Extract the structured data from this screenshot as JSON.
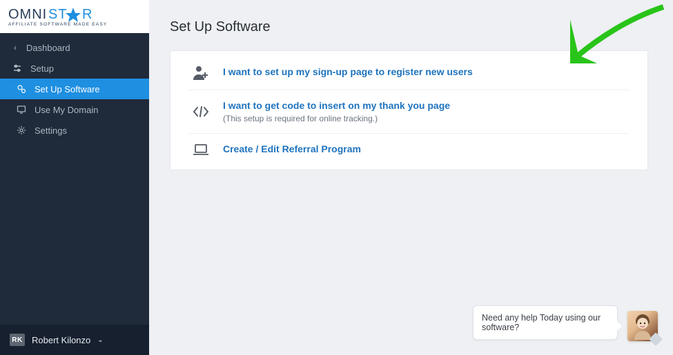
{
  "brand": {
    "name": "OMNISTAR",
    "tagline": "AFFILIATE SOFTWARE MADE EASY"
  },
  "nav": {
    "dashboard": "Dashboard",
    "setup": "Setup",
    "set_up_software": "Set Up Software",
    "use_my_domain": "Use My Domain",
    "settings": "Settings"
  },
  "user": {
    "initials": "RK",
    "name": "Robert Kilonzo"
  },
  "page": {
    "title": "Set Up Software"
  },
  "options": {
    "signup": {
      "label": "I want to set up my sign-up page to register new users"
    },
    "code": {
      "label": "I want to get code to insert on my thank you page",
      "note": "(This setup is required for online tracking.)"
    },
    "referral": {
      "label": "Create / Edit Referral Program"
    }
  },
  "chat": {
    "message": "Need any help Today using our software?"
  }
}
